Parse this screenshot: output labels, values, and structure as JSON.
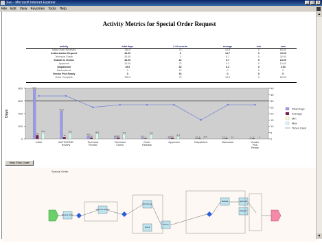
{
  "window": {
    "title": "Xeo - Microsoft Internet Explorer",
    "menu": [
      "File",
      "Edit",
      "View",
      "Favorites",
      "Tools",
      "Help"
    ]
  },
  "page": {
    "title": "Activity Metrics for Special Order Request",
    "view_button": "View Flow Chart"
  },
  "metrics_table": {
    "headers": [
      "activity",
      "total days",
      "# of records",
      "average",
      "min",
      "max"
    ],
    "rows": [
      {
        "group": false,
        "cells": [
          "Initial Order Received",
          "785.0",
          "73",
          "10.8",
          "0",
          "63.00"
        ]
      },
      {
        "group": true,
        "cells": [
          "Authorization Request",
          "44.00",
          "3",
          "14.7",
          "0",
          "44.00"
        ]
      },
      {
        "group": false,
        "cells": [
          "Technical Check",
          "26.00",
          "3",
          "8.7",
          "0",
          "26.00"
        ]
      },
      {
        "group": true,
        "cells": [
          "Submit to Vendor",
          "46.00",
          "62",
          "0.7",
          "0",
          "24.00"
        ]
      },
      {
        "group": false,
        "cells": [
          "Approved",
          "23.00",
          "73",
          "0.3",
          "0",
          "13.00"
        ]
      },
      {
        "group": true,
        "cells": [
          "Dispatched",
          "15.0",
          "62",
          "0.2",
          "0",
          "3.00"
        ]
      },
      {
        "group": false,
        "cells": [
          "Backordered",
          "0",
          "12",
          "0",
          "0",
          "0"
        ]
      },
      {
        "group": true,
        "cells": [
          "Vendor Pick Ready",
          "0",
          "62",
          "0",
          "0",
          "0"
        ]
      },
      {
        "group": false,
        "cells": [
          "Order Complete",
          "785.0",
          "73",
          "10.8",
          "0",
          "63.00"
        ]
      }
    ]
  },
  "chart_data": {
    "type": "bar",
    "categories": [
      "Initial",
      "AUTHORIZE Review",
      "Technical Review",
      "Technical Check",
      "Order Release",
      "Approved",
      "Dispatched",
      "Backorder",
      "Vendor Pick Ready"
    ],
    "ylabel": "Days",
    "ylim": [
      0,
      800
    ],
    "yticks": [
      0,
      200,
      400,
      600,
      800
    ],
    "y2lim": [
      0,
      40
    ],
    "y2ticks": [
      0,
      5,
      10,
      15,
      20,
      25,
      30,
      35,
      40
    ],
    "series": [
      {
        "name": "Total Days",
        "axis": "left",
        "values": [
          785,
          440,
          46,
          23,
          15,
          12,
          5,
          3,
          0
        ],
        "labels": [
          "785.0",
          "440.0",
          "46.0",
          "23.0",
          "15.0",
          "12.0",
          "5.0",
          "3.0",
          "0"
        ]
      },
      {
        "name": "Average",
        "axis": "left",
        "values": [
          60,
          30,
          20,
          20,
          0,
          15,
          0,
          0,
          0
        ],
        "labels": [
          "60",
          "30",
          "20",
          "20",
          "0",
          "15",
          "0",
          "0",
          "0"
        ]
      },
      {
        "name": "Min",
        "axis": "left",
        "values": [
          0,
          0,
          0,
          0,
          0,
          0,
          0,
          0,
          0
        ]
      },
      {
        "name": "Max",
        "axis": "left",
        "values": [
          95,
          90,
          80,
          75,
          70,
          40,
          10,
          2,
          0
        ],
        "labels": [
          "95.0",
          "90.0",
          "80.0",
          "75.0",
          "70.0",
          "40.0",
          "10.0",
          "2.0",
          "0"
        ]
      },
      {
        "name": "Times Used",
        "type": "line",
        "axis": "right",
        "values": [
          34,
          34,
          25,
          27,
          27,
          27,
          15,
          27,
          27
        ]
      }
    ],
    "colors": [
      "#9a9ae8",
      "#7a1e4a",
      "#fffbd0",
      "#d6f7f7",
      "#6a7fd8"
    ],
    "reference_line": 600,
    "legend": "right"
  },
  "diagram": {
    "label": "Special Order",
    "boxes": [
      {
        "label": "Receive Order"
      },
      {
        "label": "Authorize Review"
      },
      {
        "label": "Tech Review"
      },
      {
        "label": "Check"
      },
      {
        "label": "Submit"
      },
      {
        "label": "Release"
      },
      {
        "label": "Approved"
      },
      {
        "label": "Dispatch"
      },
      {
        "label": "Backorder"
      }
    ]
  },
  "colors": {
    "titlebar": "#0a246a",
    "chrome": "#d4d0c8",
    "plot_bg": "#cfcfcf",
    "header_text": "#1a237e",
    "start_node": "#6ad16a",
    "end_node": "#f48aa8",
    "task_box": "#bde3ee",
    "gateway": "#2a5ed8"
  }
}
